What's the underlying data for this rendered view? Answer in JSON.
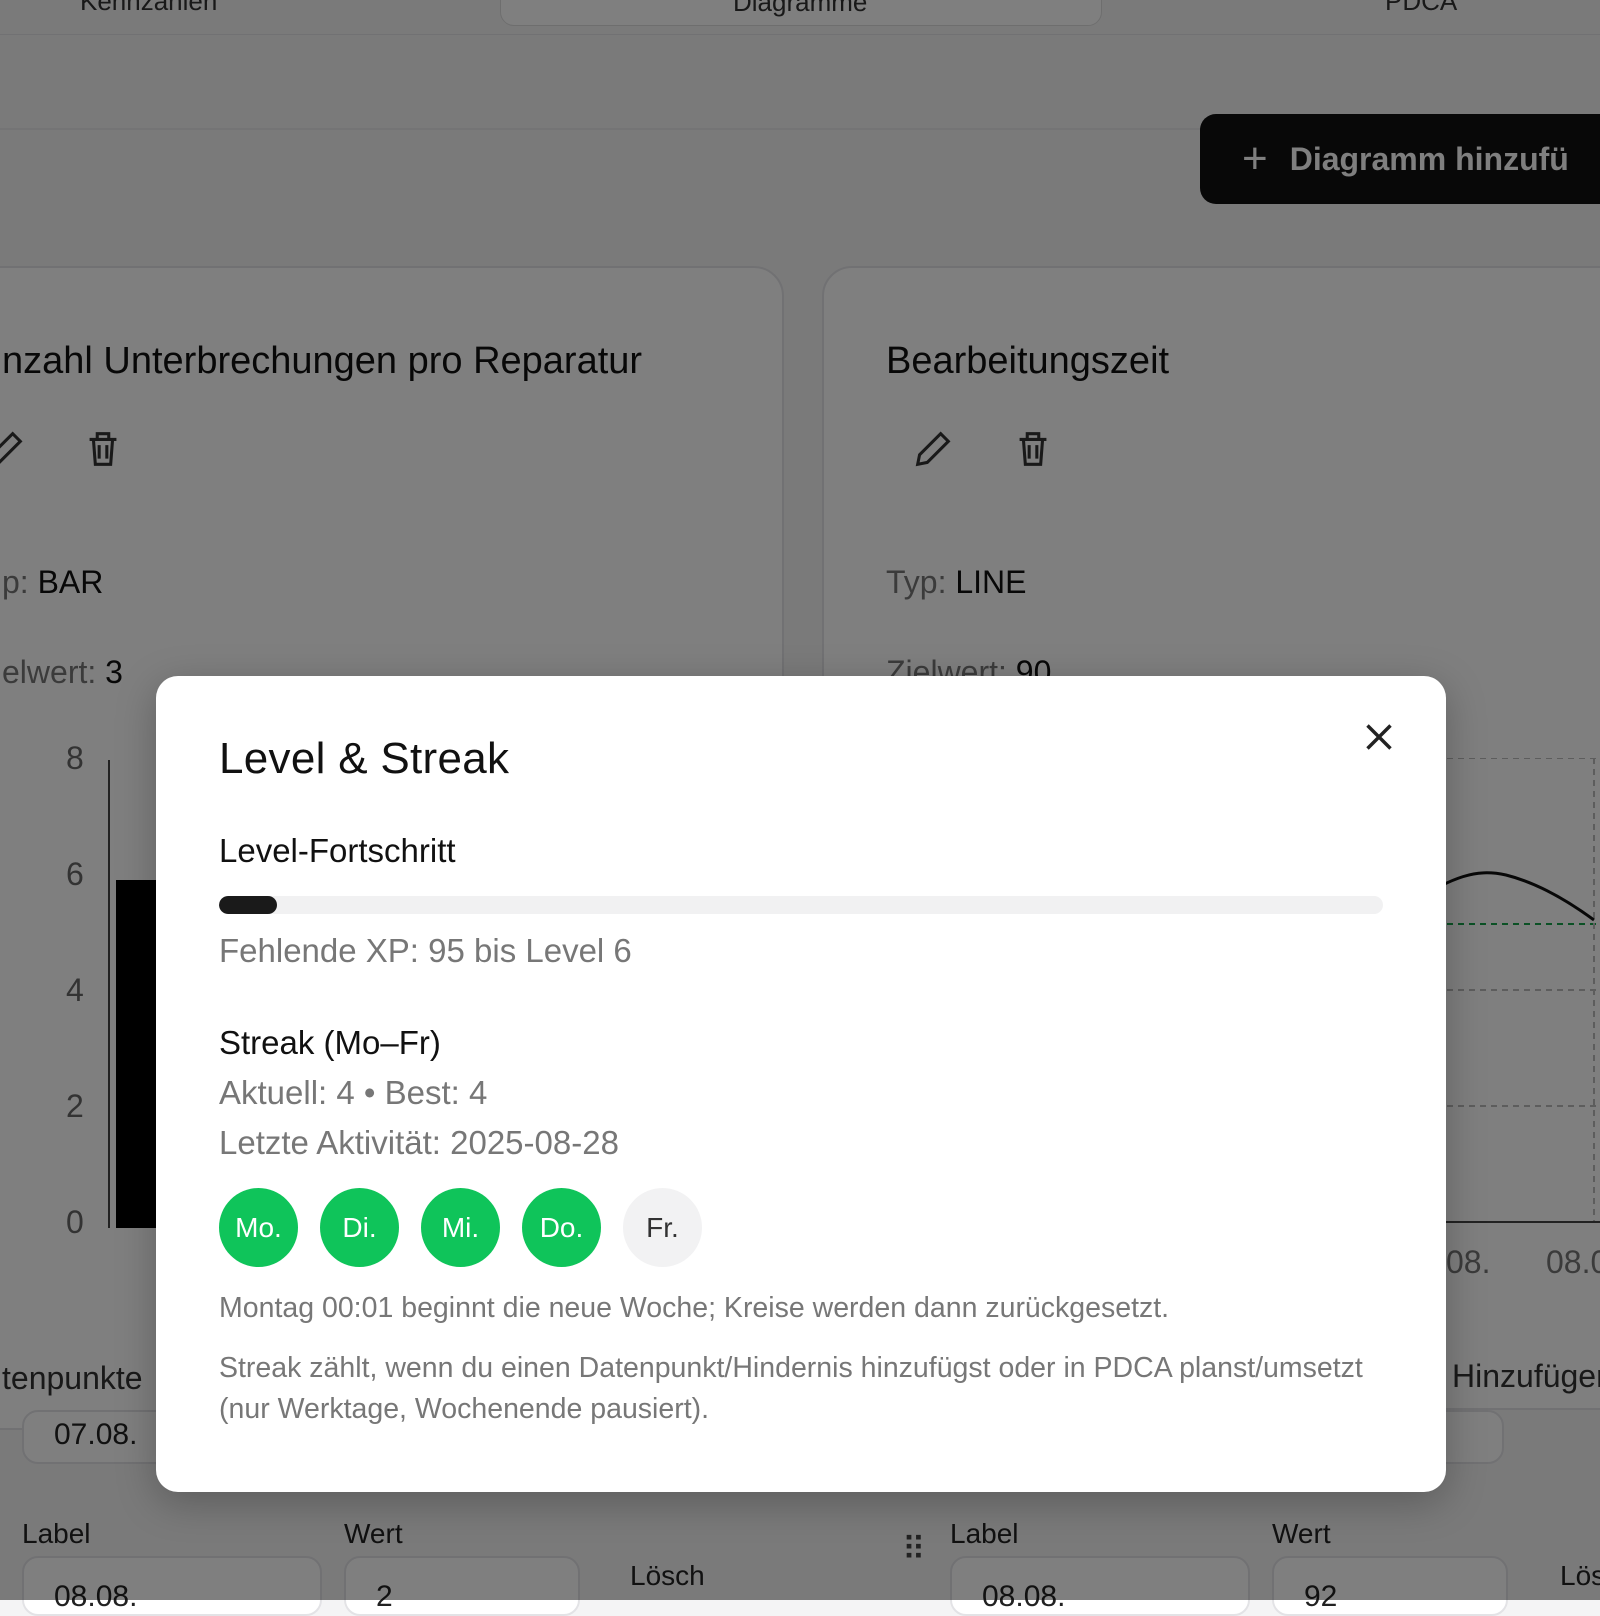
{
  "app": {
    "top_tabs": [
      "Kennzahlen",
      "Diagramme",
      "PDCA"
    ],
    "add_chart_label": "Diagramm hinzufü"
  },
  "cards": [
    {
      "title": "nzahl Unterbrechungen pro Reparatur",
      "type_label": "p:",
      "type_value": "BAR",
      "target_label": "elwert:",
      "target_value": "3",
      "y_ticks": [
        "8",
        "6",
        "4",
        "2",
        "0"
      ],
      "points_label": "tenpunkte",
      "point_row_value": "07.08.",
      "row_label_header": "Label",
      "row_value_header": "Wert",
      "row_label_value": "08.08.",
      "row_value_value": "2",
      "delete_label": "Lösch"
    },
    {
      "title": "Bearbeitungszeit",
      "type_label": "Typ:",
      "type_value": "LINE",
      "target_label": "Zielwert:",
      "target_value": "90",
      "x_ticks": [
        "08.",
        "08.0"
      ],
      "add_label": "Hinzufüger",
      "row_label_header": "Label",
      "row_value_header": "Wert",
      "row_label_value": "08.08.",
      "row_value_value": "92",
      "delete_label": "Lös"
    }
  ],
  "modal": {
    "title": "Level & Streak",
    "level_heading": "Level-Fortschritt",
    "level_progress": 0.05,
    "missing_xp": "Fehlende XP: 95 bis Level 6",
    "streak_heading": "Streak (Mo–Fr)",
    "streak_current": "Aktuell: 4 • Best: 4",
    "last_activity": "Letzte Aktivität: 2025-08-28",
    "days": [
      {
        "label": "Mo.",
        "active": true
      },
      {
        "label": "Di.",
        "active": true
      },
      {
        "label": "Mi.",
        "active": true
      },
      {
        "label": "Do.",
        "active": true
      },
      {
        "label": "Fr.",
        "active": false
      }
    ],
    "note_reset": "Montag 00:01 beginnt die neue Woche; Kreise werden dann zurückgesetzt.",
    "note_rule": "Streak zählt, wenn du einen Datenpunkt/Hindernis hinzufügst oder in PDCA planst/umsetzt (nur Werktage, Wochenende pausiert).",
    "colors": {
      "active_day": "#0fc45a",
      "progress": "#1a1a1a"
    }
  }
}
